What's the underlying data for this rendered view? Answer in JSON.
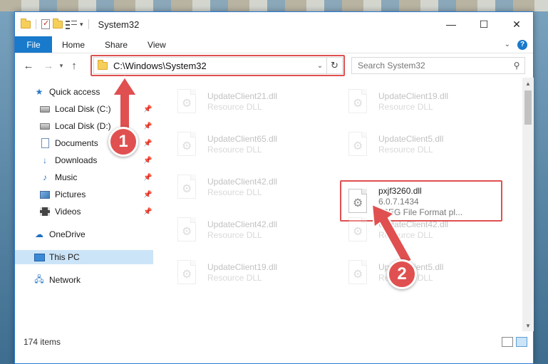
{
  "window": {
    "title": "System32",
    "controls": {
      "minimize": "—",
      "maximize": "☐",
      "close": "✕"
    }
  },
  "ribbon": {
    "file": "File",
    "tabs": [
      "Home",
      "Share",
      "View"
    ]
  },
  "address": {
    "path": "C:\\Windows\\System32",
    "search_placeholder": "Search System32"
  },
  "sidebar": {
    "items": [
      {
        "label": "Quick access",
        "icon": "star-icon"
      },
      {
        "label": "Local Disk (C:)",
        "icon": "drive-icon",
        "pinned": true
      },
      {
        "label": "Local Disk (D:)",
        "icon": "drive-icon",
        "pinned": true
      },
      {
        "label": "Documents",
        "icon": "document-icon",
        "pinned": true
      },
      {
        "label": "Downloads",
        "icon": "download-icon",
        "pinned": true
      },
      {
        "label": "Music",
        "icon": "music-icon",
        "pinned": true
      },
      {
        "label": "Pictures",
        "icon": "pictures-icon",
        "pinned": true
      },
      {
        "label": "Videos",
        "icon": "videos-icon",
        "pinned": true
      },
      {
        "label": "OneDrive",
        "icon": "cloud-icon"
      },
      {
        "label": "This PC",
        "icon": "computer-icon",
        "selected": true
      },
      {
        "label": "Network",
        "icon": "network-icon"
      }
    ]
  },
  "files": [
    {
      "name": "UpdateClient21.dll",
      "type": "Resource DLL",
      "faded": true
    },
    {
      "name": "UpdateClient19.dll",
      "type": "Resource DLL",
      "faded": true
    },
    {
      "name": "UpdateClient65.dll",
      "type": "Resource DLL",
      "faded": true
    },
    {
      "name": "UpdateClient5.dll",
      "type": "Resource DLL",
      "faded": true
    },
    {
      "name": "UpdateClient42.dll",
      "type": "Resource DLL",
      "faded": true
    },
    {
      "name": "pxjf3260.dll",
      "version": "6.0.7.1434",
      "type": "JPEG File Format pl...",
      "faded": false
    },
    {
      "name": "UpdateClient42.dll",
      "type": "Resource DLL",
      "faded": true
    },
    {
      "name": "UpdateClient42.dll",
      "type": "Resource DLL",
      "faded": true
    },
    {
      "name": "UpdateClient19.dll",
      "type": "Resource DLL",
      "faded": true
    },
    {
      "name": "UpdateClient5.dll",
      "type": "Resource DLL",
      "faded": true
    }
  ],
  "status": {
    "item_count": "174 items"
  },
  "annotations": {
    "step1": "1",
    "step2": "2",
    "color": "#e05050"
  }
}
